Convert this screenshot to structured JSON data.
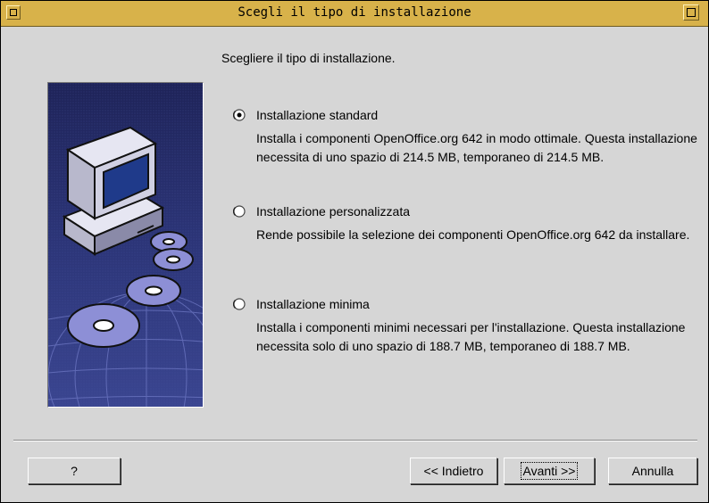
{
  "window": {
    "title": "Scegli il tipo di installazione"
  },
  "heading": "Scegliere il tipo di installazione.",
  "options": [
    {
      "label": "Installazione standard",
      "description": "Installa i componenti OpenOffice.org 642 in modo ottimale. Questa installazione necessita di uno spazio di 214.5 MB, temporaneo di 214.5 MB.",
      "selected": true
    },
    {
      "label": "Installazione personalizzata",
      "description": "Rende possibile la selezione dei componenti OpenOffice.org 642 da installare.",
      "selected": false
    },
    {
      "label": "Installazione minima",
      "description": "Installa i componenti minimi necessari per l'installazione. Questa installazione necessita solo di uno spazio di 188.7 MB, temporaneo di 188.7 MB.",
      "selected": false
    }
  ],
  "buttons": {
    "help": "?",
    "back": "<< Indietro",
    "next": "Avanti >>",
    "cancel": "Annulla"
  },
  "colors": {
    "titlebar": "#d8b24a",
    "dialog_bg": "#d6d6d6",
    "image_bg": "#27306a",
    "disc": "#8d8fd6"
  },
  "icons": {
    "side_image": "computer-with-discs-illustration"
  }
}
